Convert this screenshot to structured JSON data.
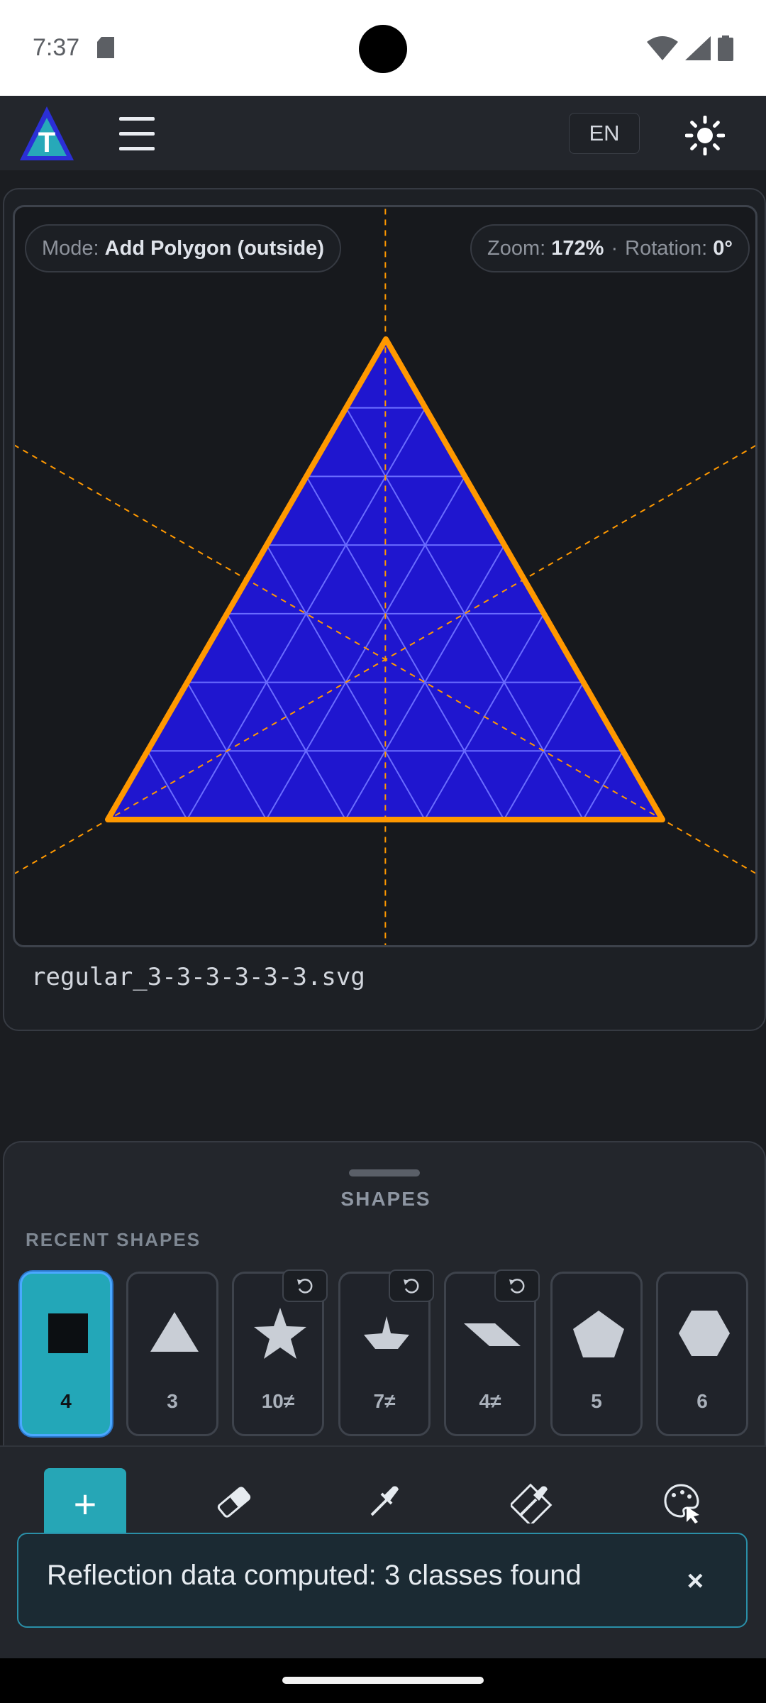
{
  "status": {
    "time": "7:37"
  },
  "app": {
    "logo_letter": "T",
    "language": "EN"
  },
  "canvas": {
    "mode_label": "Mode:",
    "mode_value": "Add Polygon (outside)",
    "zoom_label": "Zoom:",
    "zoom_value": "172%",
    "rotation_label": "Rotation:",
    "rotation_value": "0°",
    "filename": "regular_3-3-3-3-3-3.svg",
    "colors": {
      "fill": "#1f16cf",
      "outline": "#ff9800",
      "grid": "#6a6cff",
      "axis": "#ff9800"
    }
  },
  "sheet": {
    "title": "SHAPES",
    "recent_label": "RECENT SHAPES",
    "shapes": [
      {
        "label": "4",
        "icon": "square-icon",
        "selected": true
      },
      {
        "label": "3",
        "icon": "triangle-icon"
      },
      {
        "label": "10≠",
        "icon": "star-icon",
        "rotatable": true
      },
      {
        "label": "7≠",
        "icon": "heptagon-star-icon",
        "rotatable": true
      },
      {
        "label": "4≠",
        "icon": "parallelogram-icon",
        "rotatable": true
      },
      {
        "label": "5",
        "icon": "pentagon-icon"
      },
      {
        "label": "6",
        "icon": "hexagon-icon"
      }
    ]
  },
  "toolbar": {
    "add_label": "+",
    "tools": [
      "add-icon",
      "eraser-icon",
      "eyedropper-icon",
      "fill-dropper-icon",
      "palette-icon"
    ]
  },
  "toast": {
    "message": "Reflection data computed: 3 classes found",
    "close": "×"
  }
}
